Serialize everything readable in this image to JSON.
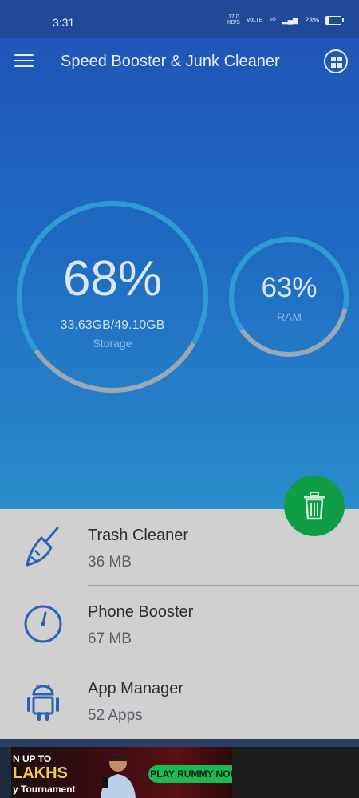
{
  "status_bar": {
    "time": "3:31",
    "net_speed_value": "17.0",
    "net_speed_unit": "KB/S",
    "volte": "VoLTE",
    "battery": "23%"
  },
  "app": {
    "title": "Speed Booster & Junk Cleaner"
  },
  "storage": {
    "percent": "68%",
    "percent_value": 68,
    "amount": "33.63GB/49.10GB",
    "label": "Storage"
  },
  "ram": {
    "percent": "63%",
    "percent_value": 63,
    "label": "RAM"
  },
  "list": [
    {
      "name": "Trash Cleaner",
      "value": "36 MB",
      "icon": "broom-icon"
    },
    {
      "name": "Phone Booster",
      "value": "67 MB",
      "icon": "speedometer-icon"
    },
    {
      "name": "App Manager",
      "value": "52 Apps",
      "icon": "android-icon"
    }
  ],
  "fab": {
    "icon": "trash-icon"
  },
  "ad": {
    "line1": "N UP TO",
    "line2": "LAKHS",
    "line3": "y Tournament",
    "cta": "PLAY RUMMY NOW"
  },
  "colors": {
    "accent_green": "#0f9d45",
    "hero_blue": "#1e6bc2",
    "list_bg": "#d0d0d0"
  }
}
